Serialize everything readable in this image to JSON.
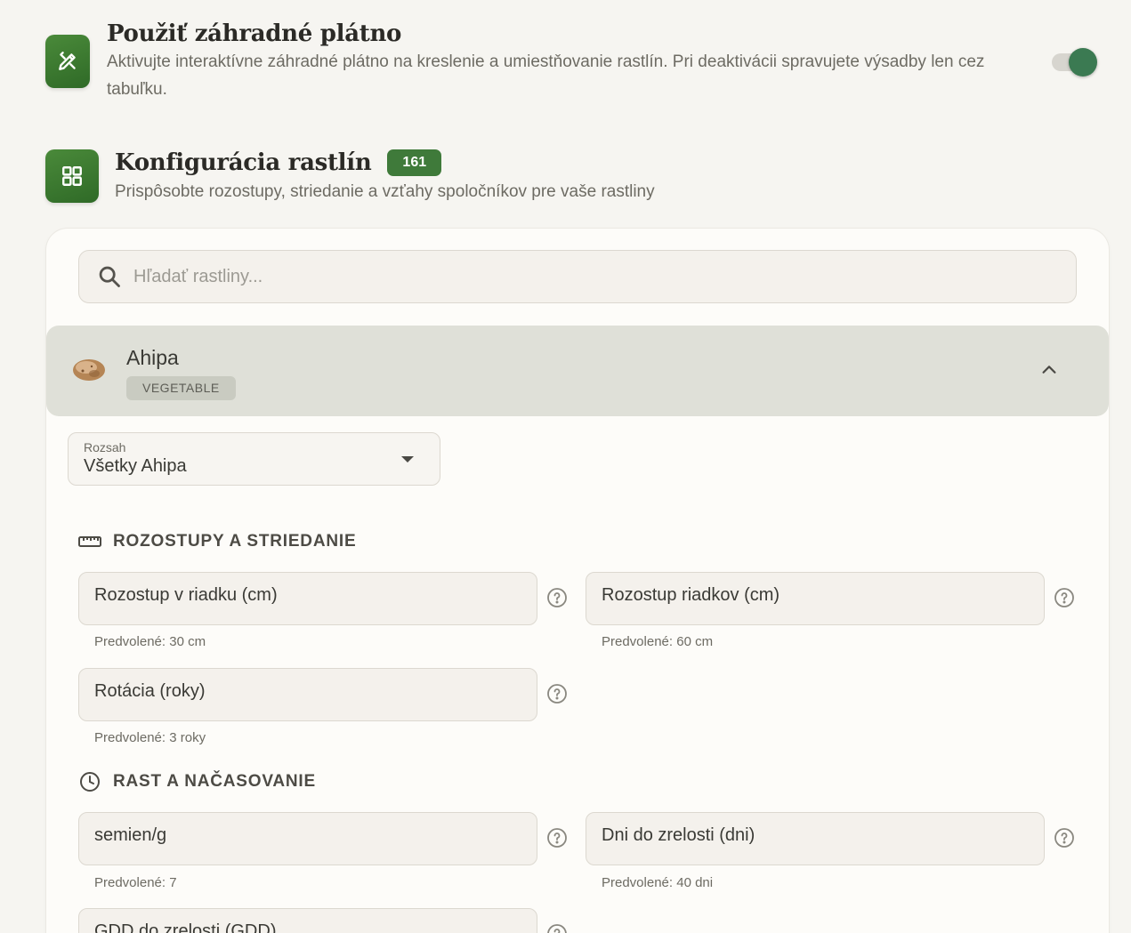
{
  "canvas_section": {
    "title": "Použiť záhradné plátno",
    "description": "Aktivujte interaktívne záhradné plátno na kreslenie a umiestňovanie rastlín. Pri deaktivácii spravujete výsadby len cez tabuľku.",
    "enabled": true
  },
  "plants_section": {
    "title": "Konfigurácia rastlín",
    "count": "161",
    "description": "Prispôsobte rozostupy, striedanie a vzťahy spoločníkov pre vaše rastliny"
  },
  "search": {
    "placeholder": "Hľadať rastliny..."
  },
  "plant": {
    "name": "Ahipa",
    "type": "VEGETABLE",
    "expanded": true
  },
  "scope_select": {
    "label": "Rozsah",
    "value": "Všetky Ahipa"
  },
  "groups": {
    "spacing": {
      "title": "ROZOSTUPY A STRIEDANIE",
      "fields": [
        {
          "label": "Rozostup v riadku (cm)",
          "hint": "Predvolené: 30 cm"
        },
        {
          "label": "Rozostup riadkov (cm)",
          "hint": "Predvolené: 60 cm"
        },
        {
          "label": "Rotácia (roky)",
          "hint": "Predvolené: 3 roky"
        }
      ]
    },
    "growth": {
      "title": "RAST A NAČASOVANIE",
      "fields": [
        {
          "label": "semien/g",
          "hint": "Predvolené: 7"
        },
        {
          "label": "Dni do zrelosti (dni)",
          "hint": "Predvolené: 40 dni"
        },
        {
          "label": "GDD do zrelosti (GDD)",
          "hint": ""
        }
      ]
    }
  },
  "colors": {
    "accent_green": "#3f7a3a",
    "toggle_on": "#3b7a52"
  }
}
